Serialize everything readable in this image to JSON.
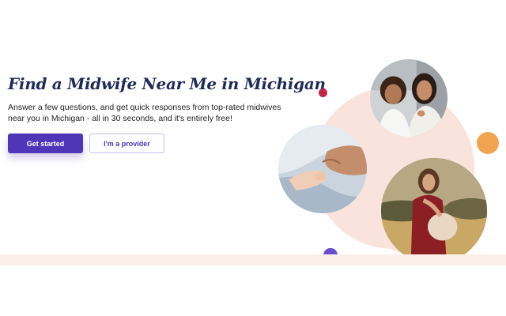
{
  "hero": {
    "title": "Find a Midwife Near Me in Michigan",
    "subtitle": "Answer a few questions, and get quick responses from top-rated midwives near you in Michigan - all in 30 seconds, and it's entirely free!",
    "primary_button": "Get started",
    "secondary_button": "I'm a provider"
  },
  "colors": {
    "brand": "#4f35b8",
    "title": "#1f2a56",
    "blob": "#fbe3dd",
    "dot_red": "#c0264a",
    "dot_orange": "#f1a450",
    "dot_purple": "#6a4cd0"
  },
  "images": [
    "child-and-mother-photo",
    "holding-baby-hand-photo",
    "pregnant-woman-photo"
  ]
}
